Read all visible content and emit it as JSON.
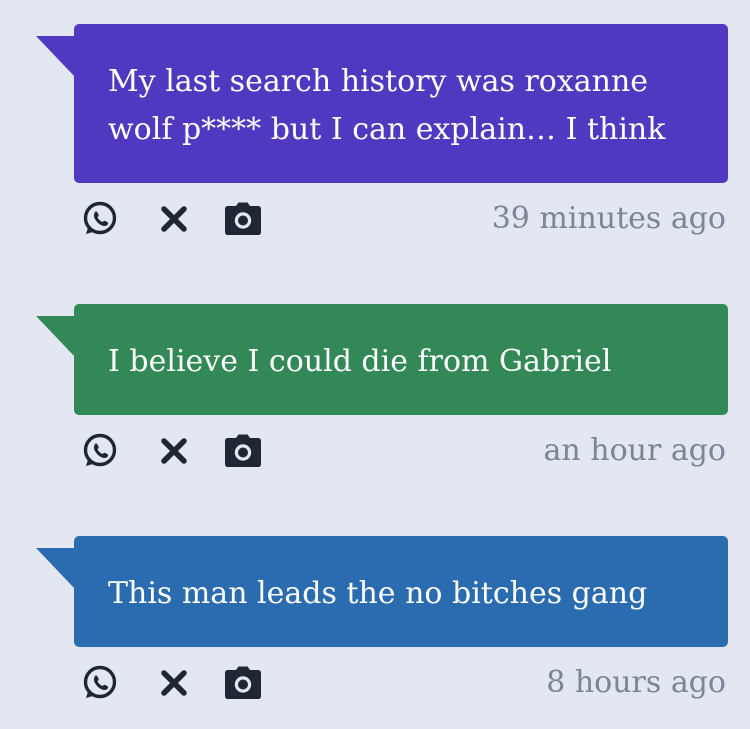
{
  "posts": [
    {
      "text": "My last search history was roxanne wolf p**** but I can explain… I think",
      "time": "39 minutes ago",
      "color": "#5039c0"
    },
    {
      "text": "I believe I could die from Gabriel",
      "time": "an hour ago",
      "color": "#328856"
    },
    {
      "text": "This man leads the no bitches gang",
      "time": "8 hours ago",
      "color": "#2b6cb0"
    }
  ],
  "icons": {
    "share": "whatsapp-icon",
    "dismiss": "close-icon",
    "capture": "camera-icon"
  }
}
